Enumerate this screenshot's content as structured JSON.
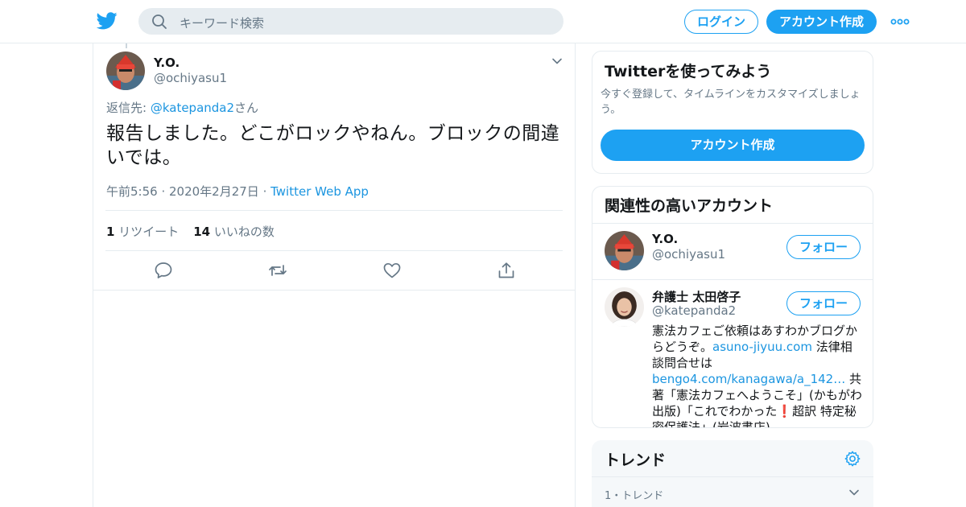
{
  "header": {
    "search_placeholder": "キーワード検索",
    "login_label": "ログイン",
    "signup_label": "アカウント作成"
  },
  "tweet": {
    "author_name": "Y.O.",
    "author_handle": "@ochiyasu1",
    "reply_prefix": "返信先: ",
    "reply_mention": "@katepanda2",
    "reply_suffix": "さん",
    "text": "報告しました。どこがロックやねん。ブロックの間違いでは。",
    "time": "午前5:56 · 2020年2月27日",
    "meta_sep": " · ",
    "source": "Twitter Web App",
    "retweet_count": "1",
    "retweet_label": "リツイート",
    "like_count": "14",
    "like_label": "いいねの数"
  },
  "signup_card": {
    "title": "Twitterを使ってみよう",
    "description": "今すぐ登録して、タイムラインをカスタマイズしましょう。",
    "button_label": "アカウント作成"
  },
  "related_card": {
    "title": "関連性の高いアカウント",
    "accounts": [
      {
        "name": "Y.O.",
        "handle": "@ochiyasu1",
        "follow_label": "フォロー"
      },
      {
        "name": "弁護士 太田啓子",
        "handle": "@katepanda2",
        "follow_label": "フォロー",
        "bio_part1": "憲法カフェご依頼はあすわかブログからどうぞ。",
        "bio_link1": "asuno-jiyuu.com",
        "bio_part2": " 法律相談問合せは",
        "bio_link2": "bengo4.com/kanagawa/a_142…",
        "bio_part3": " 共著「憲法カフェへようこそ」(かもがわ出版)「これでわかった",
        "bio_emoji": "❗",
        "bio_part4": "超訳 特定秘密保護法」(岩波書店)。"
      }
    ]
  },
  "trends": {
    "title": "トレンド",
    "first_meta": "1・トレンド"
  },
  "colors": {
    "brand": "#1da1f2",
    "link": "#1b95e0",
    "muted": "#657786",
    "border": "#e6ecf0"
  }
}
